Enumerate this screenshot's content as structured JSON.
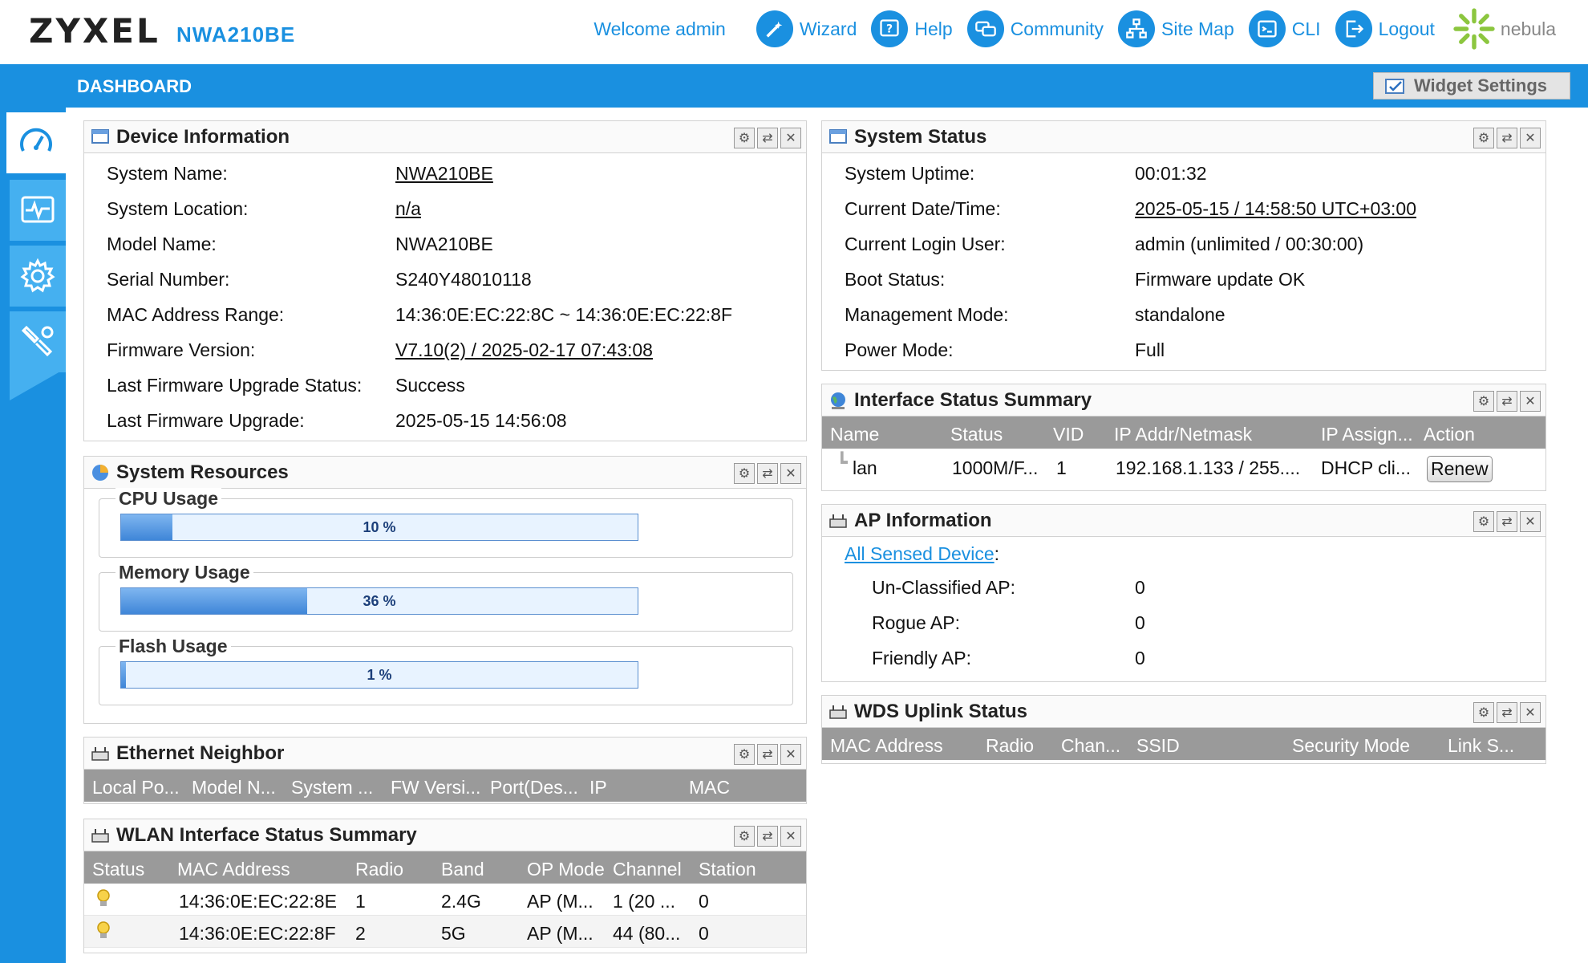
{
  "header": {
    "logo": "ZYXEL",
    "model": "NWA210BE",
    "welcome": "Welcome admin",
    "links": [
      {
        "label": "Wizard",
        "icon": "wizard-icon"
      },
      {
        "label": "Help",
        "icon": "help-icon"
      },
      {
        "label": "Community",
        "icon": "community-icon"
      },
      {
        "label": "Site Map",
        "icon": "sitemap-icon"
      },
      {
        "label": "CLI",
        "icon": "cli-icon"
      },
      {
        "label": "Logout",
        "icon": "logout-icon"
      }
    ],
    "nebula": "nebula"
  },
  "bar": {
    "title": "DASHBOARD",
    "widget_settings": "Widget Settings"
  },
  "sidebar": {
    "items": [
      {
        "icon": "dashboard-gauge-icon",
        "active": true
      },
      {
        "icon": "monitor-pulse-icon"
      },
      {
        "icon": "configuration-gear-icon"
      },
      {
        "icon": "maintenance-tools-icon"
      }
    ]
  },
  "device_info": {
    "title": "Device Information",
    "rows": [
      {
        "key": "System Name:",
        "value": "NWA210BE",
        "link": true
      },
      {
        "key": "System Location:",
        "value": "n/a",
        "link": true
      },
      {
        "key": "Model Name:",
        "value": "NWA210BE"
      },
      {
        "key": "Serial Number:",
        "value": "S240Y48010118"
      },
      {
        "key": "MAC Address Range:",
        "value": "14:36:0E:EC:22:8C ~ 14:36:0E:EC:22:8F"
      },
      {
        "key": "Firmware Version:",
        "value": "V7.10(2) / 2025-02-17 07:43:08",
        "link": true
      },
      {
        "key": "Last Firmware Upgrade Status:",
        "value": "Success"
      },
      {
        "key": "Last Firmware Upgrade:",
        "value": "2025-05-15 14:56:08"
      }
    ]
  },
  "system_status": {
    "title": "System Status",
    "rows": [
      {
        "key": "System Uptime:",
        "value": "00:01:32"
      },
      {
        "key": "Current Date/Time:",
        "value": "2025-05-15 / 14:58:50 UTC+03:00",
        "link": true
      },
      {
        "key": "Current Login User:",
        "value": "admin (unlimited / 00:30:00)"
      },
      {
        "key": "Boot Status:",
        "value": "Firmware update OK"
      },
      {
        "key": "Management Mode:",
        "value": "standalone"
      },
      {
        "key": "Power Mode:",
        "value": "Full"
      }
    ]
  },
  "system_resources": {
    "title": "System Resources",
    "cpu": {
      "label": "CPU Usage",
      "text": "10 %",
      "percent": 10
    },
    "memory": {
      "label": "Memory Usage",
      "text": "36 %",
      "percent": 36
    },
    "flash": {
      "label": "Flash Usage",
      "text": "1 %",
      "percent": 1
    }
  },
  "interface_summary": {
    "title": "Interface Status Summary",
    "columns": [
      "Name",
      "Status",
      "VID",
      "IP Addr/Netmask",
      "IP Assign...",
      "Action"
    ],
    "rows": [
      {
        "name": "lan",
        "status": "1000M/F...",
        "vid": "1",
        "ip": "192.168.1.133 / 255....",
        "assign": "DHCP cli...",
        "action": "Renew"
      }
    ]
  },
  "ap_info": {
    "title": "AP Information",
    "sensed_link": "All Sensed Device",
    "colon": ":",
    "rows": [
      {
        "key": "Un-Classified AP:",
        "value": "0"
      },
      {
        "key": "Rogue AP:",
        "value": "0"
      },
      {
        "key": "Friendly AP:",
        "value": "0"
      }
    ]
  },
  "wds_uplink": {
    "title": "WDS Uplink Status",
    "columns": [
      "MAC Address",
      "Radio",
      "Chan...",
      "SSID",
      "Security Mode",
      "Link S..."
    ]
  },
  "ethernet_neighbor": {
    "title": "Ethernet Neighbor",
    "columns": [
      "Local Po...",
      "Model N...",
      "System ...",
      "FW Versi...",
      "Port(Des...",
      "IP",
      "MAC"
    ]
  },
  "wlan_summary": {
    "title": "WLAN Interface Status Summary",
    "columns": [
      "Status",
      "MAC Address",
      "Radio",
      "Band",
      "OP Mode",
      "Channel",
      "Station"
    ],
    "rows": [
      {
        "mac": "14:36:0E:EC:22:8E",
        "radio": "1",
        "band": "2.4G",
        "op": "AP (M...",
        "channel": "1 (20 ...",
        "station": "0"
      },
      {
        "mac": "14:36:0E:EC:22:8F",
        "radio": "2",
        "band": "5G",
        "op": "AP (M...",
        "channel": "44 (80...",
        "station": "0"
      }
    ]
  },
  "colors": {
    "accent": "#1a90e0",
    "grid_header": "#9a9a9a"
  }
}
